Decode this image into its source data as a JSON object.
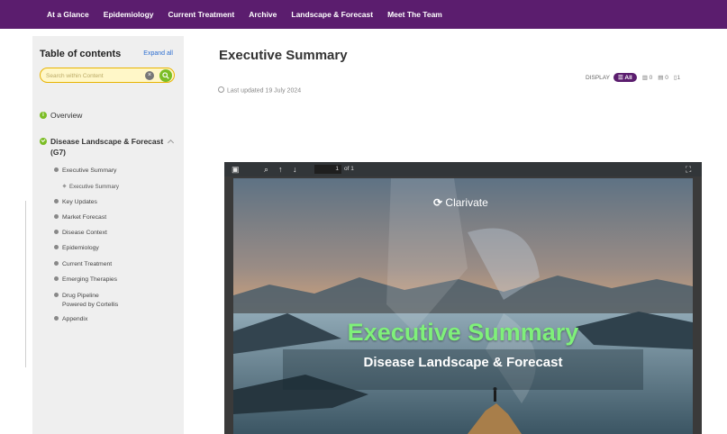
{
  "nav": {
    "items": [
      "At a Glance",
      "Epidemiology",
      "Current Treatment",
      "Archive",
      "Landscape & Forecast",
      "Meet The Team"
    ]
  },
  "sidebar": {
    "title": "Table of contents",
    "expand_all": "Expand all",
    "search_placeholder": "Search within Content",
    "overview": "Overview",
    "section_title_line1": "Disease Landscape & Forecast",
    "section_title_line2": "(G7)",
    "sub_items": [
      "Executive Summary",
      "Key Updates",
      "Market Forecast",
      "Disease Context",
      "Epidemiology",
      "Current Treatment",
      "Emerging Therapies",
      "Drug Pipeline",
      "Appendix"
    ],
    "drug_pipeline_sub": "Powered by Cortellis",
    "exec_summary_child": "Executive Summary"
  },
  "main": {
    "title": "Executive Summary",
    "last_updated": "Last updated 19 July 2024",
    "display": {
      "label": "DISPLAY",
      "all": "All",
      "charts_count": "0",
      "tables_count": "0",
      "docs_count": "1"
    }
  },
  "viewer": {
    "page_current": "1",
    "page_of": "of 1"
  },
  "slide": {
    "brand": "Clarivate",
    "title": "Executive Summary",
    "subtitle": "Disease Landscape & Forecast"
  },
  "colors": {
    "nav_bg": "#5b1d6e",
    "accent_green": "#7bbd25",
    "slide_title_green": "#7ff07a",
    "search_border": "#e8b400"
  }
}
